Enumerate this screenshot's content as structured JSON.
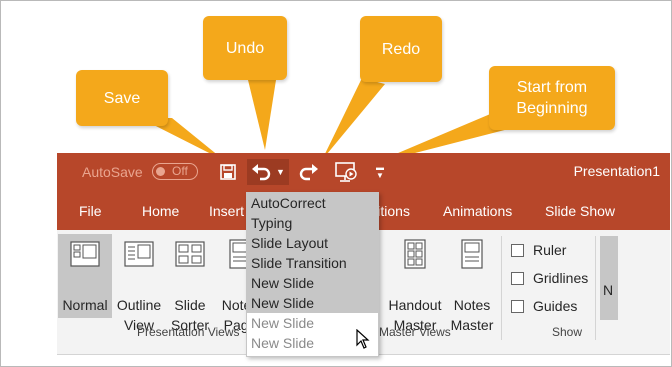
{
  "callouts": {
    "save": "Save",
    "undo": "Undo",
    "redo": "Redo",
    "start": "Start from Beginning"
  },
  "titlebar": {
    "autosave_label": "AutoSave",
    "autosave_state": "Off",
    "document_title": "Presentation1",
    "icons": [
      "save-icon",
      "undo-icon",
      "undo-dropdown-icon",
      "redo-icon",
      "start-from-beginning-icon",
      "customize-qat-icon"
    ]
  },
  "tabs": [
    "File",
    "Home",
    "Insert",
    "Transitions",
    "Animations",
    "Slide Show"
  ],
  "ribbon": {
    "presentation_views": {
      "label": "Presentation Views",
      "normal": "Normal",
      "outline_view": [
        "Outline",
        "View"
      ],
      "slide_sorter": [
        "Slide",
        "Sorter"
      ],
      "notes_page": [
        "Notes",
        "Page"
      ]
    },
    "master_views": {
      "label": "Master Views",
      "handout_master": [
        "Handout",
        "Master"
      ],
      "notes_master": [
        "Notes",
        "Master"
      ]
    },
    "show": {
      "label": "Show",
      "ruler": "Ruler",
      "gridlines": "Gridlines",
      "guides": "Guides"
    },
    "partial_label": "N"
  },
  "undo_list": {
    "items": [
      {
        "label": "AutoCorrect",
        "state": "selected"
      },
      {
        "label": "Typing",
        "state": "selected"
      },
      {
        "label": "Slide Layout",
        "state": "selected"
      },
      {
        "label": "Slide Transition",
        "state": "selected"
      },
      {
        "label": "New Slide",
        "state": "selected"
      },
      {
        "label": "New Slide",
        "state": "selected"
      },
      {
        "label": "New Slide",
        "state": "normal"
      },
      {
        "label": "New Slide",
        "state": "normal"
      }
    ]
  },
  "colors": {
    "ribbon_accent": "#b7472a",
    "callout": "#f4a81b",
    "ribbon_bg": "#f3f3f3",
    "selection": "#c6c6c6"
  }
}
